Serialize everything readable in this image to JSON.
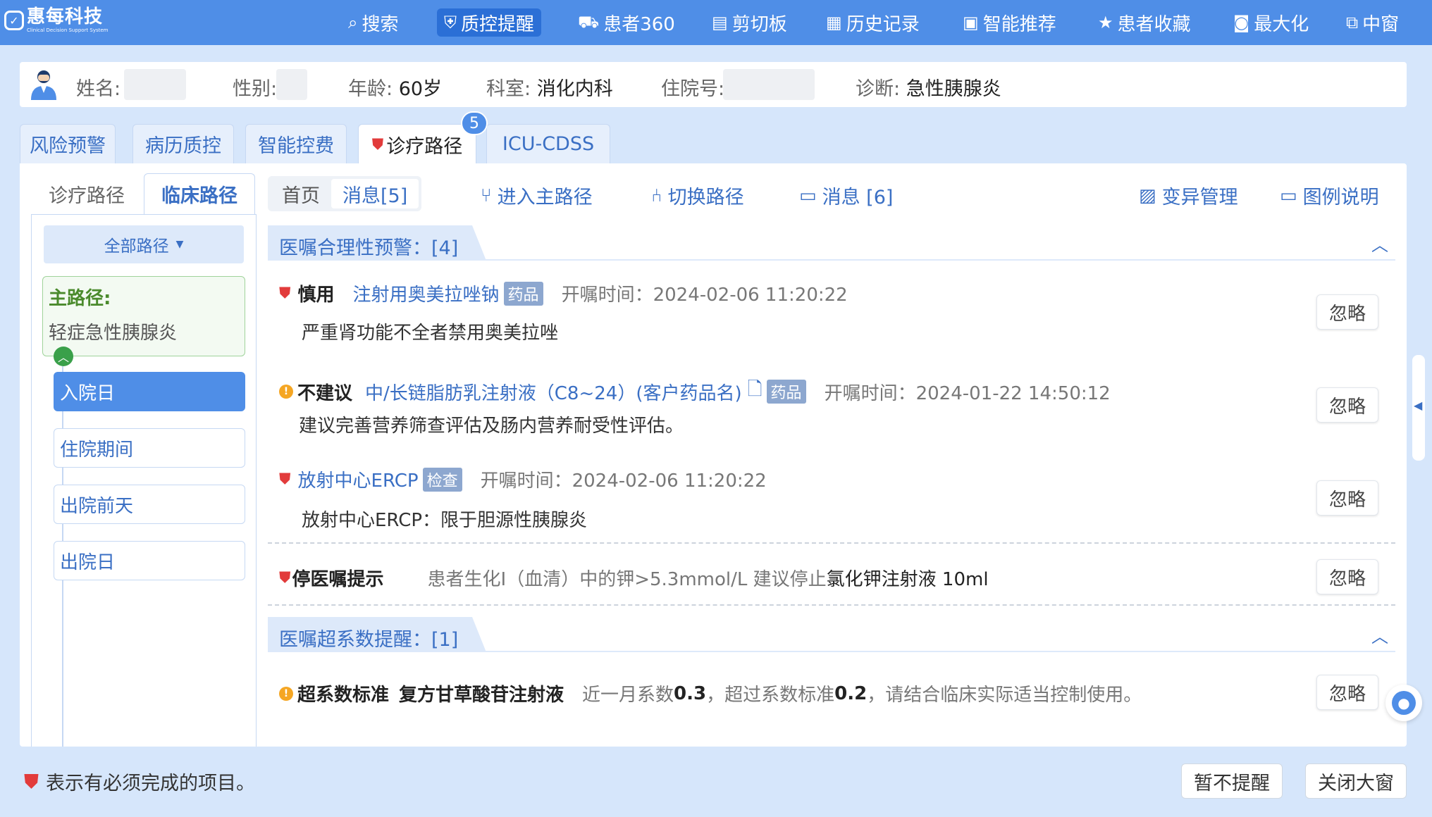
{
  "logo": {
    "name": "惠每科技",
    "subtitle": "Clinical Decision Support System"
  },
  "nav": [
    {
      "label": "搜索",
      "icon": "search-icon"
    },
    {
      "label": "质控提醒",
      "icon": "shield-check-icon"
    },
    {
      "label": "患者360",
      "icon": "patient-icon"
    },
    {
      "label": "剪切板",
      "icon": "clipboard-icon"
    },
    {
      "label": "历史记录",
      "icon": "history-icon"
    },
    {
      "label": "智能推荐",
      "icon": "recommend-icon"
    },
    {
      "label": "患者收藏",
      "icon": "star-icon"
    },
    {
      "label": "最大化",
      "icon": "maximize-icon"
    },
    {
      "label": "中窗",
      "icon": "medium-window-icon"
    }
  ],
  "patient": {
    "name_label": "姓名:",
    "gender_label": "性别:",
    "age_label": "年龄:",
    "age": "60岁",
    "dept_label": "科室:",
    "dept": "消化内科",
    "inpatient_label": "住院号:",
    "diagnosis_label": "诊断:",
    "diagnosis": "急性胰腺炎"
  },
  "tabs": [
    "风险预警",
    "病历质控",
    "智能控费",
    "诊疗路径",
    "ICU-CDSS"
  ],
  "tab_badge": "5",
  "sidebar": {
    "tabs": [
      "诊疗路径",
      "临床路径"
    ],
    "all_paths": "全部路径",
    "main_path_title": "主路径:",
    "main_path_name": "轻症急性胰腺炎",
    "steps": [
      "入院日",
      "住院期间",
      "出院前天",
      "出院日"
    ]
  },
  "subnav": {
    "home": "首页",
    "messages": "消息[5]"
  },
  "toolbar": {
    "enter_main": "进入主路径",
    "switch_path": "切换路径",
    "messages": "消息 [6]",
    "variation": "变异管理",
    "legend": "图例说明"
  },
  "sections": {
    "s1": "医嘱合理性预警：[4]",
    "s2": "医嘱超系数提醒：[1]"
  },
  "alerts": {
    "a1": {
      "level": "慎用",
      "drug": "注射用奥美拉唑钠",
      "tag": "药品",
      "time": "开嘱时间：2024-02-06 11:20:22",
      "desc": "严重肾功能不全者禁用奥美拉唑"
    },
    "a2": {
      "level": "不建议",
      "drug": "中/长链脂肪乳注射液（C8~24）(客户药品名)",
      "tag": "药品",
      "time": "开嘱时间：2024-01-22 14:50:12",
      "desc": "建议完善营养筛查评估及肠内营养耐受性评估。"
    },
    "a3": {
      "drug": "放射中心ERCP",
      "tag": "检查",
      "time": "开嘱时间：2024-02-06 11:20:22",
      "desc": "放射中心ERCP：限于胆源性胰腺炎"
    },
    "a4": {
      "level": "停医嘱提示",
      "text1": "患者生化Ⅰ（血清）中的钾>5.3mmol/L  建议停止",
      "text2": "氯化钾注射液 10ml"
    },
    "a5": {
      "level": "超系数标准",
      "drug": "复方甘草酸苷注射液",
      "t1": "近一月系数",
      "v1": "0.3",
      "t2": "，超过系数标准",
      "v2": "0.2",
      "t3": "，请结合临床实际适当控制使用。"
    }
  },
  "ignore_label": "忽略",
  "footer": {
    "note": "表示有必须完成的项目。",
    "snooze": "暂不提醒",
    "close": "关闭大窗"
  }
}
